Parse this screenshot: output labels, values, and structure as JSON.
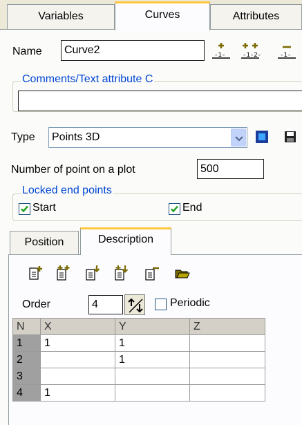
{
  "top_tabs": [
    {
      "label": "Variables"
    },
    {
      "label": "Curves"
    },
    {
      "label": "Attributes"
    }
  ],
  "name_label": "Name",
  "name_value": "Curve2",
  "comments_legend": "Comments/Text attribute C",
  "comments_value": "",
  "type_label": "Type",
  "type_value": "Points 3D",
  "num_points_label": "Number of point on a plot",
  "num_points_value": "500",
  "locked_legend": "Locked end points",
  "start_label": "Start",
  "start_checked": true,
  "end_label": "End",
  "end_checked": true,
  "inner_tabs": [
    {
      "label": "Position"
    },
    {
      "label": "Description"
    }
  ],
  "order_label": "Order",
  "order_value": "4",
  "periodic_label": "Periodic",
  "periodic_checked": false,
  "grid": {
    "headers": [
      "N",
      "X",
      "Y",
      "Z"
    ],
    "rows": [
      [
        "1",
        "1",
        "1",
        ""
      ],
      [
        "2",
        "",
        "1",
        ""
      ],
      [
        "3",
        "",
        "",
        ""
      ],
      [
        "4",
        "1",
        "",
        ""
      ]
    ]
  },
  "colors": {
    "accent_tab": "#ffc83c",
    "legend_blue": "#0046d5",
    "check_green": "#21a121"
  }
}
